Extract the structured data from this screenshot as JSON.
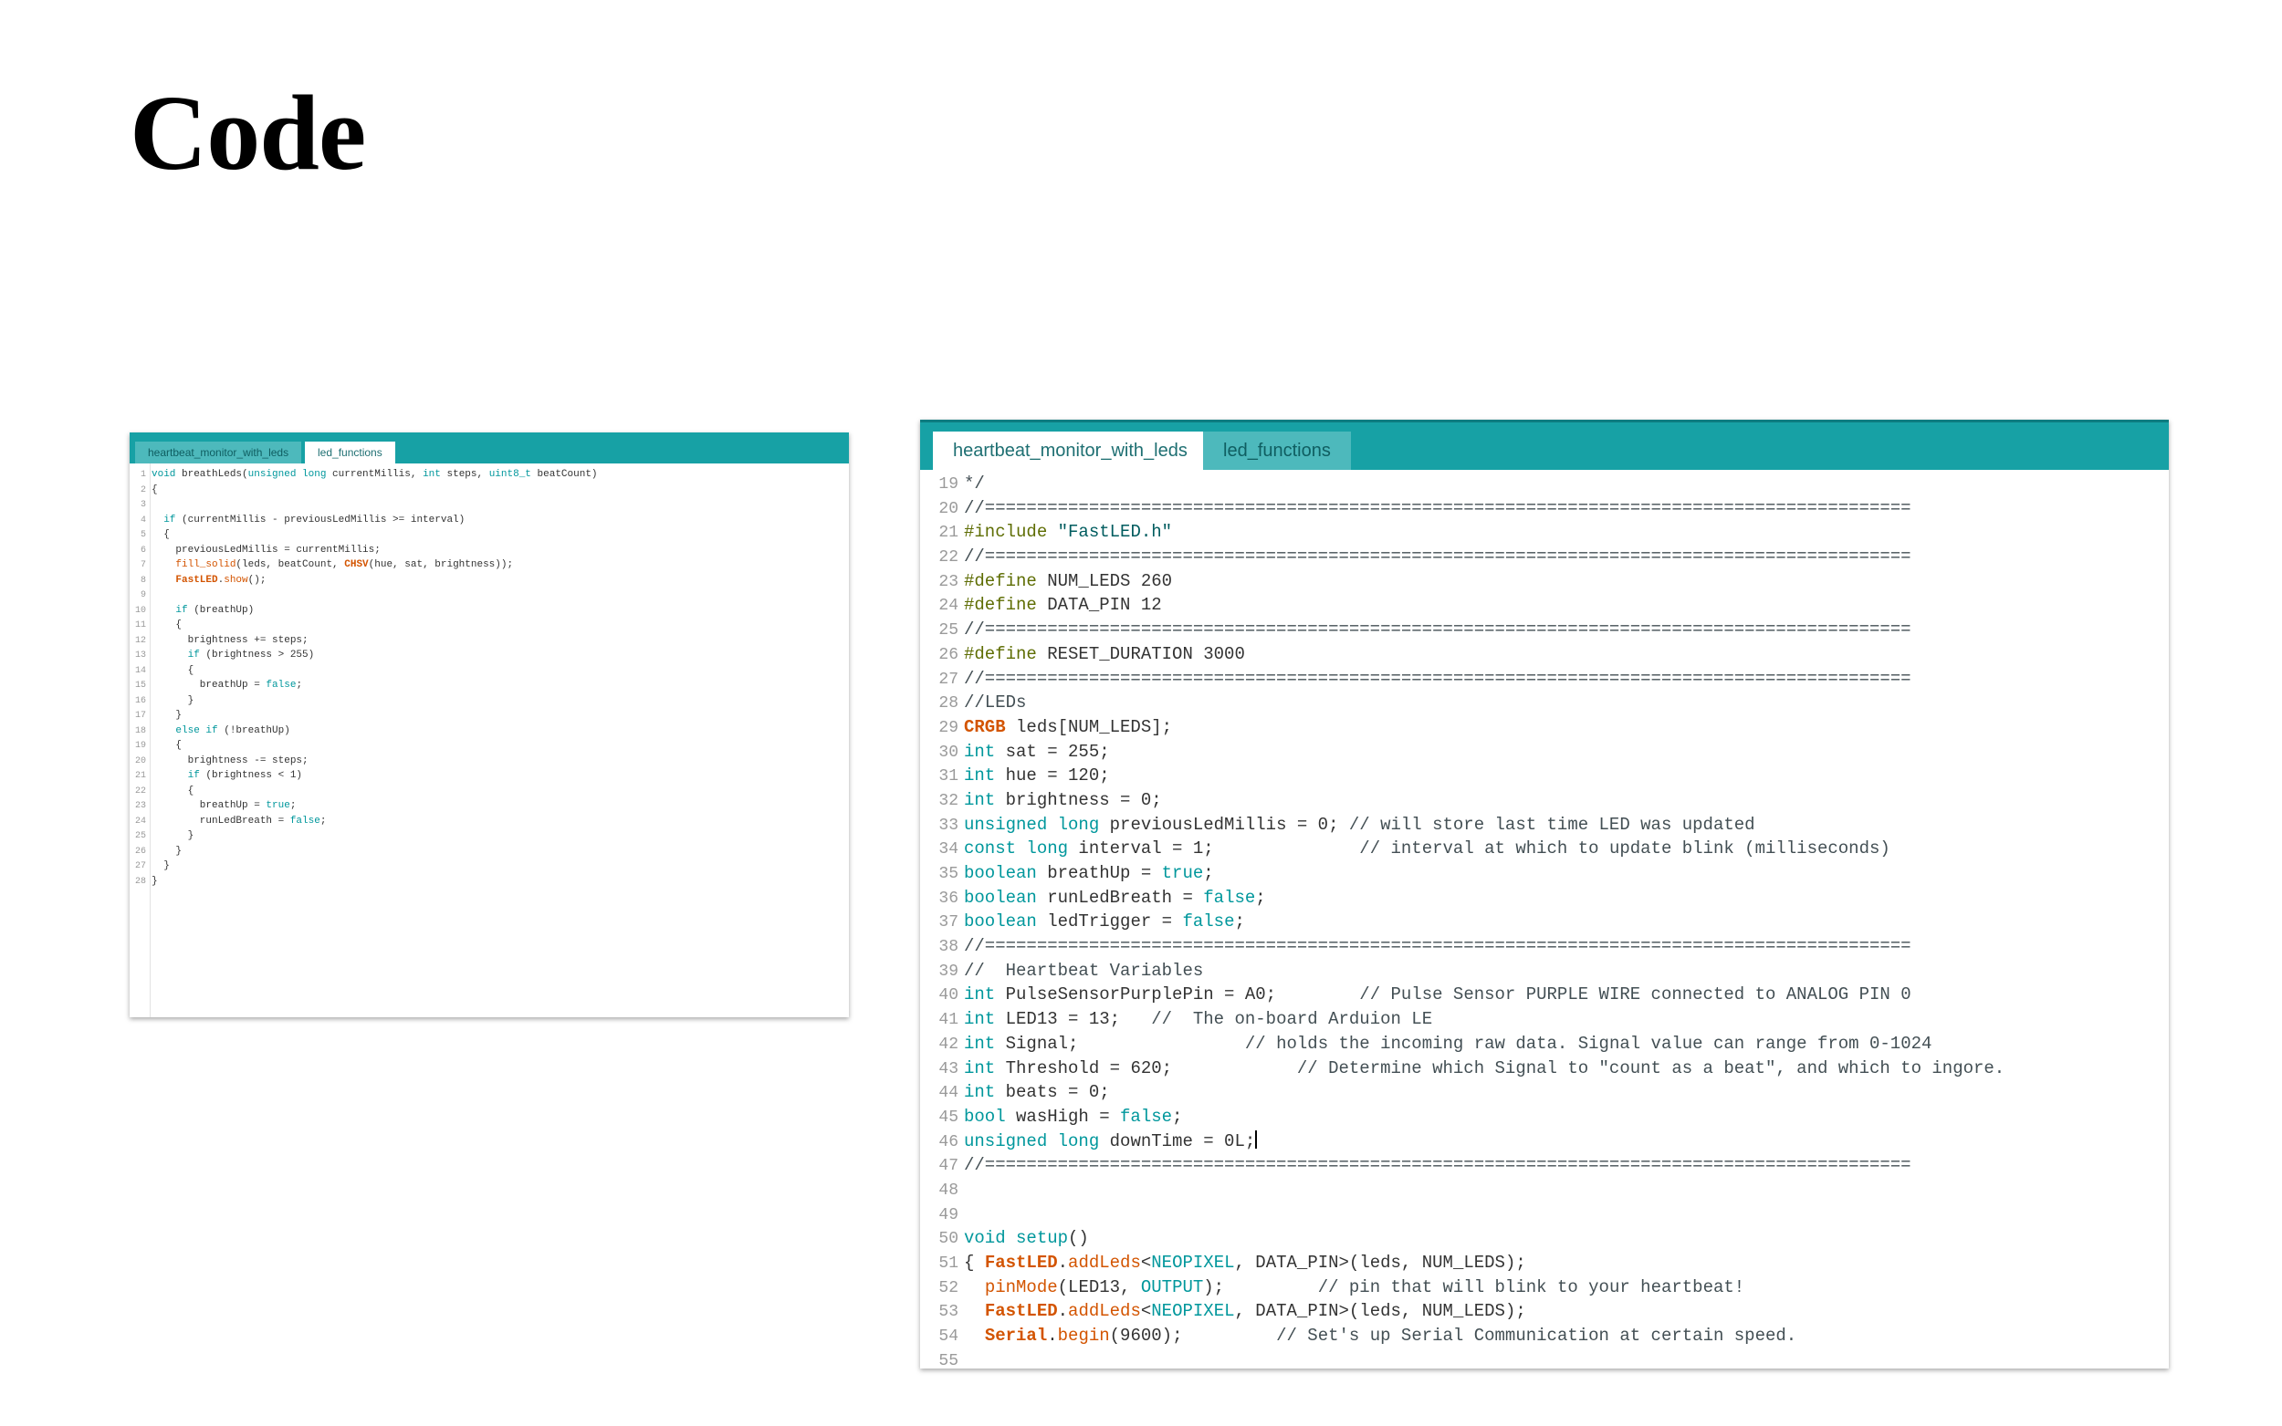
{
  "slide": {
    "title": "Code"
  },
  "small_ide": {
    "tabs": [
      {
        "label": "heartbeat_monitor_with_leds",
        "active": false
      },
      {
        "label": "led_functions",
        "active": true
      }
    ],
    "lines": [
      {
        "n": "1",
        "t": [
          [
            "kw",
            "void"
          ],
          [
            "p",
            " breathLeds("
          ],
          [
            "kw",
            "unsigned long"
          ],
          [
            "p",
            " currentMillis, "
          ],
          [
            "kw",
            "int"
          ],
          [
            "p",
            " steps, "
          ],
          [
            "kw",
            "uint8_t"
          ],
          [
            "p",
            " beatCount)"
          ]
        ]
      },
      {
        "n": "2",
        "t": [
          [
            "p",
            "{"
          ]
        ]
      },
      {
        "n": "3",
        "t": []
      },
      {
        "n": "4",
        "t": [
          [
            "p",
            "  "
          ],
          [
            "kw",
            "if"
          ],
          [
            "p",
            " (currentMillis - previousLedMillis >= interval)"
          ]
        ]
      },
      {
        "n": "5",
        "t": [
          [
            "p",
            "  {"
          ]
        ]
      },
      {
        "n": "6",
        "t": [
          [
            "p",
            "    previousLedMillis = currentMillis;"
          ]
        ]
      },
      {
        "n": "7",
        "t": [
          [
            "p",
            "    "
          ],
          [
            "fn",
            "fill_solid"
          ],
          [
            "p",
            "(leds, beatCount, "
          ],
          [
            "obj",
            "CHSV"
          ],
          [
            "p",
            "(hue, sat, brightness));"
          ]
        ]
      },
      {
        "n": "8",
        "t": [
          [
            "p",
            "    "
          ],
          [
            "obj",
            "FastLED"
          ],
          [
            "p",
            "."
          ],
          [
            "fn",
            "show"
          ],
          [
            "p",
            "();"
          ]
        ]
      },
      {
        "n": "9",
        "t": []
      },
      {
        "n": "10",
        "t": [
          [
            "p",
            "    "
          ],
          [
            "kw",
            "if"
          ],
          [
            "p",
            " (breathUp)"
          ]
        ]
      },
      {
        "n": "11",
        "t": [
          [
            "p",
            "    {"
          ]
        ]
      },
      {
        "n": "12",
        "t": [
          [
            "p",
            "      brightness += steps;"
          ]
        ]
      },
      {
        "n": "13",
        "t": [
          [
            "p",
            "      "
          ],
          [
            "kw",
            "if"
          ],
          [
            "p",
            " (brightness > 255)"
          ]
        ]
      },
      {
        "n": "14",
        "t": [
          [
            "p",
            "      {"
          ]
        ]
      },
      {
        "n": "15",
        "t": [
          [
            "p",
            "        breathUp = "
          ],
          [
            "kw",
            "false"
          ],
          [
            "p",
            ";"
          ]
        ]
      },
      {
        "n": "16",
        "t": [
          [
            "p",
            "      }"
          ]
        ]
      },
      {
        "n": "17",
        "t": [
          [
            "p",
            "    }"
          ]
        ]
      },
      {
        "n": "18",
        "t": [
          [
            "p",
            "    "
          ],
          [
            "kw",
            "else if"
          ],
          [
            "p",
            " (!breathUp)"
          ]
        ]
      },
      {
        "n": "19",
        "t": [
          [
            "p",
            "    {"
          ]
        ]
      },
      {
        "n": "20",
        "t": [
          [
            "p",
            "      brightness -= steps;"
          ]
        ]
      },
      {
        "n": "21",
        "t": [
          [
            "p",
            "      "
          ],
          [
            "kw",
            "if"
          ],
          [
            "p",
            " (brightness < 1)"
          ]
        ]
      },
      {
        "n": "22",
        "t": [
          [
            "p",
            "      {"
          ]
        ]
      },
      {
        "n": "23",
        "t": [
          [
            "p",
            "        breathUp = "
          ],
          [
            "kw",
            "true"
          ],
          [
            "p",
            ";"
          ]
        ]
      },
      {
        "n": "24",
        "t": [
          [
            "p",
            "        runLedBreath = "
          ],
          [
            "kw",
            "false"
          ],
          [
            "p",
            ";"
          ]
        ]
      },
      {
        "n": "25",
        "t": [
          [
            "p",
            "      }"
          ]
        ]
      },
      {
        "n": "26",
        "t": [
          [
            "p",
            "    }"
          ]
        ]
      },
      {
        "n": "27",
        "t": [
          [
            "p",
            "  }"
          ]
        ]
      },
      {
        "n": "28",
        "t": [
          [
            "p",
            "}"
          ]
        ]
      }
    ]
  },
  "big_ide": {
    "tabs": [
      {
        "label": "heartbeat_monitor_with_leds",
        "active": true
      },
      {
        "label": "led_functions",
        "active": false
      }
    ],
    "lines": [
      {
        "n": "19",
        "t": [
          [
            "cm",
            "*/"
          ]
        ]
      },
      {
        "n": "20",
        "t": [
          [
            "cm",
            "//========================================================================================="
          ]
        ]
      },
      {
        "n": "21",
        "t": [
          [
            "pp",
            "#include"
          ],
          [
            "p",
            " "
          ],
          [
            "str",
            "\"FastLED.h\""
          ]
        ]
      },
      {
        "n": "22",
        "t": [
          [
            "cm",
            "//========================================================================================="
          ]
        ]
      },
      {
        "n": "23",
        "t": [
          [
            "pp",
            "#define"
          ],
          [
            "p",
            " NUM_LEDS 260"
          ]
        ]
      },
      {
        "n": "24",
        "t": [
          [
            "pp",
            "#define"
          ],
          [
            "p",
            " DATA_PIN 12"
          ]
        ]
      },
      {
        "n": "25",
        "t": [
          [
            "cm",
            "//========================================================================================="
          ]
        ]
      },
      {
        "n": "26",
        "t": [
          [
            "pp",
            "#define"
          ],
          [
            "p",
            " RESET_DURATION 3000"
          ]
        ]
      },
      {
        "n": "27",
        "t": [
          [
            "cm",
            "//========================================================================================="
          ]
        ]
      },
      {
        "n": "28",
        "t": [
          [
            "cm",
            "//LEDs"
          ]
        ]
      },
      {
        "n": "29",
        "t": [
          [
            "obj",
            "CRGB"
          ],
          [
            "p",
            " leds[NUM_LEDS];"
          ]
        ]
      },
      {
        "n": "30",
        "t": [
          [
            "kw",
            "int"
          ],
          [
            "p",
            " sat = 255;"
          ]
        ]
      },
      {
        "n": "31",
        "t": [
          [
            "kw",
            "int"
          ],
          [
            "p",
            " hue = 120;"
          ]
        ]
      },
      {
        "n": "32",
        "t": [
          [
            "kw",
            "int"
          ],
          [
            "p",
            " brightness = 0;"
          ]
        ]
      },
      {
        "n": "33",
        "t": [
          [
            "kw",
            "unsigned long"
          ],
          [
            "p",
            " previousLedMillis = 0; "
          ],
          [
            "cm",
            "// will store last time LED was updated"
          ]
        ]
      },
      {
        "n": "34",
        "t": [
          [
            "kw",
            "const long"
          ],
          [
            "p",
            " interval = 1;              "
          ],
          [
            "cm",
            "// interval at which to update blink (milliseconds)"
          ]
        ]
      },
      {
        "n": "35",
        "t": [
          [
            "kw",
            "boolean"
          ],
          [
            "p",
            " breathUp = "
          ],
          [
            "kw",
            "true"
          ],
          [
            "p",
            ";"
          ]
        ]
      },
      {
        "n": "36",
        "t": [
          [
            "kw",
            "boolean"
          ],
          [
            "p",
            " runLedBreath = "
          ],
          [
            "kw",
            "false"
          ],
          [
            "p",
            ";"
          ]
        ]
      },
      {
        "n": "37",
        "t": [
          [
            "kw",
            "boolean"
          ],
          [
            "p",
            " ledTrigger = "
          ],
          [
            "kw",
            "false"
          ],
          [
            "p",
            ";"
          ]
        ]
      },
      {
        "n": "38",
        "t": [
          [
            "cm",
            "//========================================================================================="
          ]
        ]
      },
      {
        "n": "39",
        "t": [
          [
            "cm",
            "//  Heartbeat Variables"
          ]
        ]
      },
      {
        "n": "40",
        "t": [
          [
            "kw",
            "int"
          ],
          [
            "p",
            " PulseSensorPurplePin = A0;        "
          ],
          [
            "cm",
            "// Pulse Sensor PURPLE WIRE connected to ANALOG PIN 0"
          ]
        ]
      },
      {
        "n": "41",
        "t": [
          [
            "kw",
            "int"
          ],
          [
            "p",
            " LED13 = 13;   "
          ],
          [
            "cm",
            "//  The on-board Arduion LE"
          ]
        ]
      },
      {
        "n": "42",
        "t": [
          [
            "kw",
            "int"
          ],
          [
            "p",
            " Signal;                "
          ],
          [
            "cm",
            "// holds the incoming raw data. Signal value can range from 0-1024"
          ]
        ]
      },
      {
        "n": "43",
        "t": [
          [
            "kw",
            "int"
          ],
          [
            "p",
            " Threshold = 620;            "
          ],
          [
            "cm",
            "// Determine which Signal to \"count as a beat\", and which to ingore."
          ]
        ]
      },
      {
        "n": "44",
        "t": [
          [
            "kw",
            "int"
          ],
          [
            "p",
            " beats = 0;"
          ]
        ]
      },
      {
        "n": "45",
        "t": [
          [
            "kw",
            "bool"
          ],
          [
            "p",
            " wasHigh = "
          ],
          [
            "kw",
            "false"
          ],
          [
            "p",
            ";"
          ]
        ]
      },
      {
        "n": "46",
        "t": [
          [
            "kw",
            "unsigned long"
          ],
          [
            "p",
            " downTime = 0L;"
          ]
        ],
        "caret": true
      },
      {
        "n": "47",
        "t": [
          [
            "cm",
            "//========================================================================================="
          ]
        ]
      },
      {
        "n": "48",
        "t": []
      },
      {
        "n": "49",
        "t": []
      },
      {
        "n": "50",
        "t": [
          [
            "kw",
            "void"
          ],
          [
            "p",
            " "
          ],
          [
            "kw",
            "setup"
          ],
          [
            "p",
            "()"
          ]
        ]
      },
      {
        "n": "51",
        "t": [
          [
            "p",
            "{ "
          ],
          [
            "obj",
            "FastLED"
          ],
          [
            "p",
            "."
          ],
          [
            "fn",
            "addLeds"
          ],
          [
            "p",
            "<"
          ],
          [
            "kw",
            "NEOPIXEL"
          ],
          [
            "p",
            ", DATA_PIN>(leds, NUM_LEDS);"
          ]
        ]
      },
      {
        "n": "52",
        "t": [
          [
            "p",
            "  "
          ],
          [
            "fn",
            "pinMode"
          ],
          [
            "p",
            "(LED13, "
          ],
          [
            "kw",
            "OUTPUT"
          ],
          [
            "p",
            ");         "
          ],
          [
            "cm",
            "// pin that will blink to your heartbeat!"
          ]
        ]
      },
      {
        "n": "53",
        "t": [
          [
            "p",
            "  "
          ],
          [
            "obj",
            "FastLED"
          ],
          [
            "p",
            "."
          ],
          [
            "fn",
            "addLeds"
          ],
          [
            "p",
            "<"
          ],
          [
            "kw",
            "NEOPIXEL"
          ],
          [
            "p",
            ", DATA_PIN>(leds, NUM_LEDS);"
          ]
        ]
      },
      {
        "n": "54",
        "t": [
          [
            "p",
            "  "
          ],
          [
            "obj",
            "Serial"
          ],
          [
            "p",
            "."
          ],
          [
            "fn",
            "begin"
          ],
          [
            "p",
            "(9600);         "
          ],
          [
            "cm",
            "// Set's up Serial Communication at certain speed."
          ]
        ]
      },
      {
        "n": "55",
        "t": []
      }
    ]
  }
}
